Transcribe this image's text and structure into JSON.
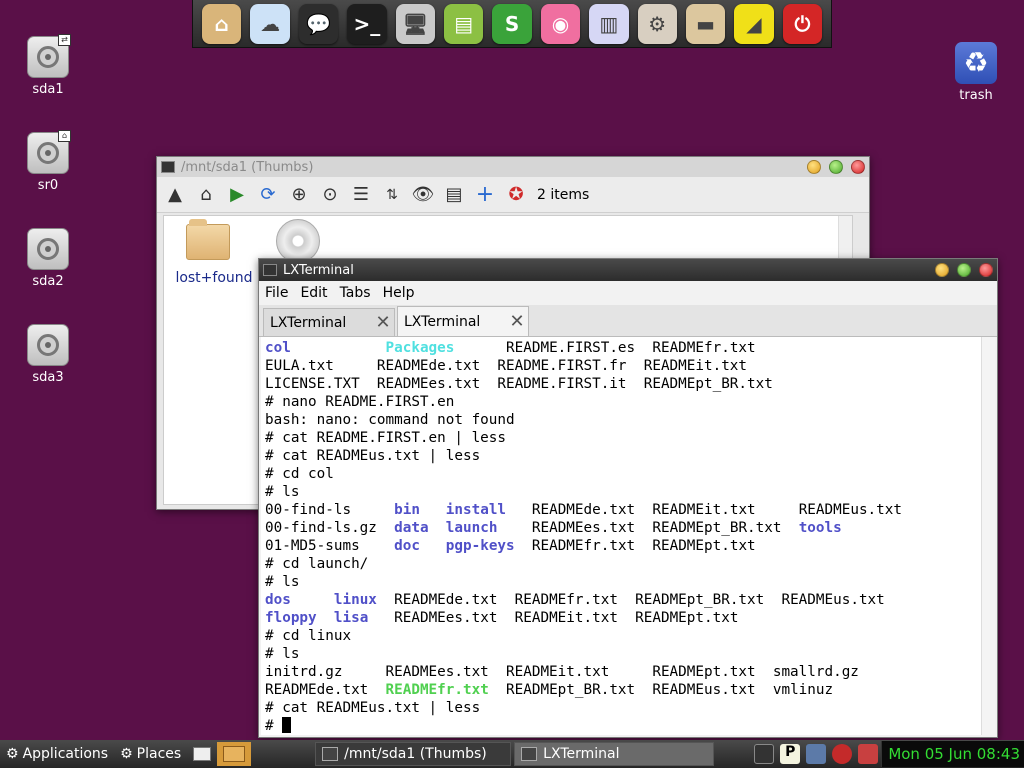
{
  "dock": {
    "items": [
      {
        "name": "home-folder",
        "color": "#d9b57a",
        "glyph": "⌂"
      },
      {
        "name": "cloud",
        "color": "#cde2f7",
        "glyph": "☁"
      },
      {
        "name": "chat",
        "color": "#2d2d2d",
        "glyph": "💬"
      },
      {
        "name": "terminal",
        "color": "#1e1e1e",
        "glyph": ">_"
      },
      {
        "name": "display",
        "color": "#c9c9c9",
        "glyph": "🖥"
      },
      {
        "name": "document",
        "color": "#8cc043",
        "glyph": "▤"
      },
      {
        "name": "spreadsheet",
        "color": "#3aa33a",
        "glyph": "S"
      },
      {
        "name": "color",
        "color": "#f06fa0",
        "glyph": "◉"
      },
      {
        "name": "notes",
        "color": "#d6d7f5",
        "glyph": "▥"
      },
      {
        "name": "settings",
        "color": "#d8cfc1",
        "glyph": "⚙"
      },
      {
        "name": "box",
        "color": "#dcc79e",
        "glyph": "▬"
      },
      {
        "name": "ruler",
        "color": "#f0e018",
        "glyph": "◢"
      },
      {
        "name": "power",
        "color": "#d42626",
        "glyph": "⏻"
      }
    ]
  },
  "desktop": {
    "icons": [
      {
        "label": "sda1"
      },
      {
        "label": "sr0"
      },
      {
        "label": "sda2"
      },
      {
        "label": "sda3"
      }
    ],
    "trash_label": "trash"
  },
  "file_manager": {
    "title": "/mnt/sda1 (Thumbs)",
    "items_count": "2 items",
    "folder_label": "lost+found"
  },
  "terminal": {
    "title": "LXTerminal",
    "menu": [
      "File",
      "Edit",
      "Tabs",
      "Help"
    ],
    "tabs": [
      {
        "label": "LXTerminal",
        "active": false
      },
      {
        "label": "LXTerminal",
        "active": true
      }
    ],
    "lines": [
      [
        [
          "col",
          "dir"
        ],
        [
          "           ",
          ""
        ],
        [
          "Packages",
          "link"
        ],
        [
          "      README.FIRST.es  READMEfr.txt",
          ""
        ]
      ],
      [
        [
          "EULA.txt     READMEde.txt  README.FIRST.fr  READMEit.txt",
          ""
        ]
      ],
      [
        [
          "LICENSE.TXT  READMEes.txt  README.FIRST.it  READMEpt_BR.txt",
          ""
        ]
      ],
      [
        [
          "# nano README.FIRST.en",
          ""
        ]
      ],
      [
        [
          "bash: nano: command not found",
          ""
        ]
      ],
      [
        [
          "# cat README.FIRST.en | less",
          ""
        ]
      ],
      [
        [
          "# cat READMEus.txt | less",
          ""
        ]
      ],
      [
        [
          "# cd col",
          ""
        ]
      ],
      [
        [
          "# ls",
          ""
        ]
      ],
      [
        [
          "00-find-ls     ",
          ""
        ],
        [
          "bin",
          "dir"
        ],
        [
          "   ",
          ""
        ],
        [
          "install",
          "dir"
        ],
        [
          "   READMEde.txt  READMEit.txt     READMEus.txt",
          ""
        ]
      ],
      [
        [
          "00-find-ls.gz  ",
          ""
        ],
        [
          "data",
          "dir"
        ],
        [
          "  ",
          ""
        ],
        [
          "launch",
          "dir"
        ],
        [
          "    READMEes.txt  READMEpt_BR.txt  ",
          ""
        ],
        [
          "tools",
          "dir"
        ]
      ],
      [
        [
          "01-MD5-sums    ",
          ""
        ],
        [
          "doc",
          "dir"
        ],
        [
          "   ",
          ""
        ],
        [
          "pgp-keys",
          "dir"
        ],
        [
          "  READMEfr.txt  READMEpt.txt",
          ""
        ]
      ],
      [
        [
          "# cd launch/",
          ""
        ]
      ],
      [
        [
          "# ls",
          ""
        ]
      ],
      [
        [
          "dos",
          "dir"
        ],
        [
          "     ",
          ""
        ],
        [
          "linux",
          "dir"
        ],
        [
          "  READMEde.txt  READMEfr.txt  READMEpt_BR.txt  READMEus.txt",
          ""
        ]
      ],
      [
        [
          "floppy",
          "dir"
        ],
        [
          "  ",
          ""
        ],
        [
          "lisa",
          "dir"
        ],
        [
          "   READMEes.txt  READMEit.txt  READMEpt.txt",
          ""
        ]
      ],
      [
        [
          "# cd linux",
          ""
        ]
      ],
      [
        [
          "# ls",
          ""
        ]
      ],
      [
        [
          "initrd.gz     READMEes.txt  READMEit.txt     READMEpt.txt  smallrd.gz",
          ""
        ]
      ],
      [
        [
          "READMEde.txt  ",
          ""
        ],
        [
          "READMEfr.txt",
          "exe"
        ],
        [
          "  READMEpt_BR.txt  READMEus.txt  vmlinuz",
          ""
        ]
      ],
      [
        [
          "# cat READMEus.txt | less",
          ""
        ]
      ],
      [
        [
          "# ",
          ""
        ]
      ]
    ]
  },
  "taskbar": {
    "applications": "Applications",
    "places": "Places",
    "tasks": [
      {
        "label": "/mnt/sda1 (Thumbs)",
        "active": false
      },
      {
        "label": "LXTerminal",
        "active": true
      }
    ],
    "clock": "Mon 05 Jun 08:43"
  }
}
